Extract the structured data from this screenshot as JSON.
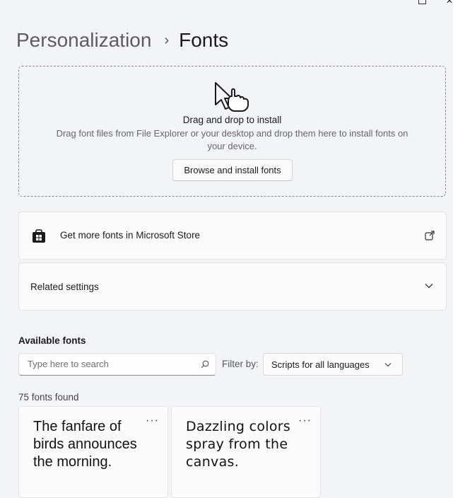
{
  "breadcrumb": {
    "parent": "Personalization",
    "separator": "›",
    "current": "Fonts"
  },
  "dropzone": {
    "title": "Drag and drop to install",
    "description": "Drag font files from File Explorer or your desktop and drop them here to install fonts on your device.",
    "button_label": "Browse and install fonts",
    "icon": "drag-drop-cursor-icon"
  },
  "store_card": {
    "label": "Get more fonts in Microsoft Store",
    "icon": "microsoft-store-icon",
    "action_icon": "external-link-icon"
  },
  "related_card": {
    "label": "Related settings",
    "action_icon": "chevron-down-icon"
  },
  "available": {
    "title": "Available fonts",
    "search": {
      "placeholder": "Type here to search",
      "value": ""
    },
    "filter_label": "Filter by:",
    "filter_value": "Scripts for all languages",
    "count_text": "75 fonts found",
    "fonts": [
      {
        "sample": "The fanfare of birds announces the morning.",
        "more": "···"
      },
      {
        "sample": "Dazzling colors spray from the canvas.",
        "more": "···"
      }
    ]
  }
}
